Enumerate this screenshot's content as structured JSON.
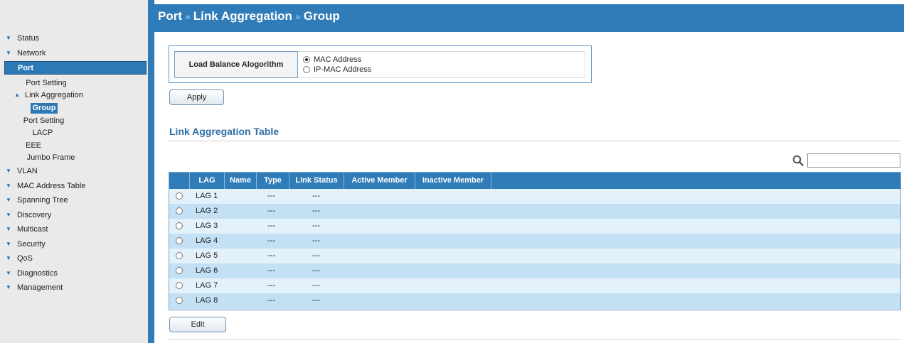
{
  "sidebar": {
    "items": [
      {
        "label": "Status"
      },
      {
        "label": "Network"
      },
      {
        "label": "Port"
      },
      {
        "label": "Port Setting"
      },
      {
        "label": "Link Aggregation"
      },
      {
        "label": "Group"
      },
      {
        "label": "Port Setting"
      },
      {
        "label": "LACP"
      },
      {
        "label": "EEE"
      },
      {
        "label": "Jumbo Frame"
      },
      {
        "label": "VLAN"
      },
      {
        "label": "MAC Address Table"
      },
      {
        "label": "Spanning Tree"
      },
      {
        "label": "Discovery"
      },
      {
        "label": "Multicast"
      },
      {
        "label": "Security"
      },
      {
        "label": "QoS"
      },
      {
        "label": "Diagnostics"
      },
      {
        "label": "Management"
      }
    ]
  },
  "header": {
    "crumb1": "Port",
    "crumb2": "Link Aggregation",
    "crumb3": "Group",
    "separator": "»"
  },
  "load_balance": {
    "label": "Load Balance Alogorithm",
    "options": [
      {
        "label": "MAC Address",
        "selected": true
      },
      {
        "label": "IP-MAC Address",
        "selected": false
      }
    ]
  },
  "apply_label": "Apply",
  "table_title": "Link Aggregation Table",
  "search": {
    "placeholder": "",
    "value": ""
  },
  "table": {
    "columns": [
      "LAG",
      "Name",
      "Type",
      "Link Status",
      "Active Member",
      "Inactive Member"
    ],
    "rows": [
      {
        "lag": "LAG 1",
        "name": "",
        "type": "---",
        "link_status": "---",
        "active": "",
        "inactive": ""
      },
      {
        "lag": "LAG 2",
        "name": "",
        "type": "---",
        "link_status": "---",
        "active": "",
        "inactive": ""
      },
      {
        "lag": "LAG 3",
        "name": "",
        "type": "---",
        "link_status": "---",
        "active": "",
        "inactive": ""
      },
      {
        "lag": "LAG 4",
        "name": "",
        "type": "---",
        "link_status": "---",
        "active": "",
        "inactive": ""
      },
      {
        "lag": "LAG 5",
        "name": "",
        "type": "---",
        "link_status": "---",
        "active": "",
        "inactive": ""
      },
      {
        "lag": "LAG 6",
        "name": "",
        "type": "---",
        "link_status": "---",
        "active": "",
        "inactive": ""
      },
      {
        "lag": "LAG 7",
        "name": "",
        "type": "---",
        "link_status": "---",
        "active": "",
        "inactive": ""
      },
      {
        "lag": "LAG 8",
        "name": "",
        "type": "---",
        "link_status": "---",
        "active": "",
        "inactive": ""
      }
    ]
  },
  "edit_label": "Edit",
  "colors": {
    "header_blue": "#2f7cb9",
    "sidebar_bg": "#eaeaea",
    "row_light": "#e3f1fb",
    "row_dark": "#c3e0f5",
    "title_blue": "#2f6ea5"
  }
}
